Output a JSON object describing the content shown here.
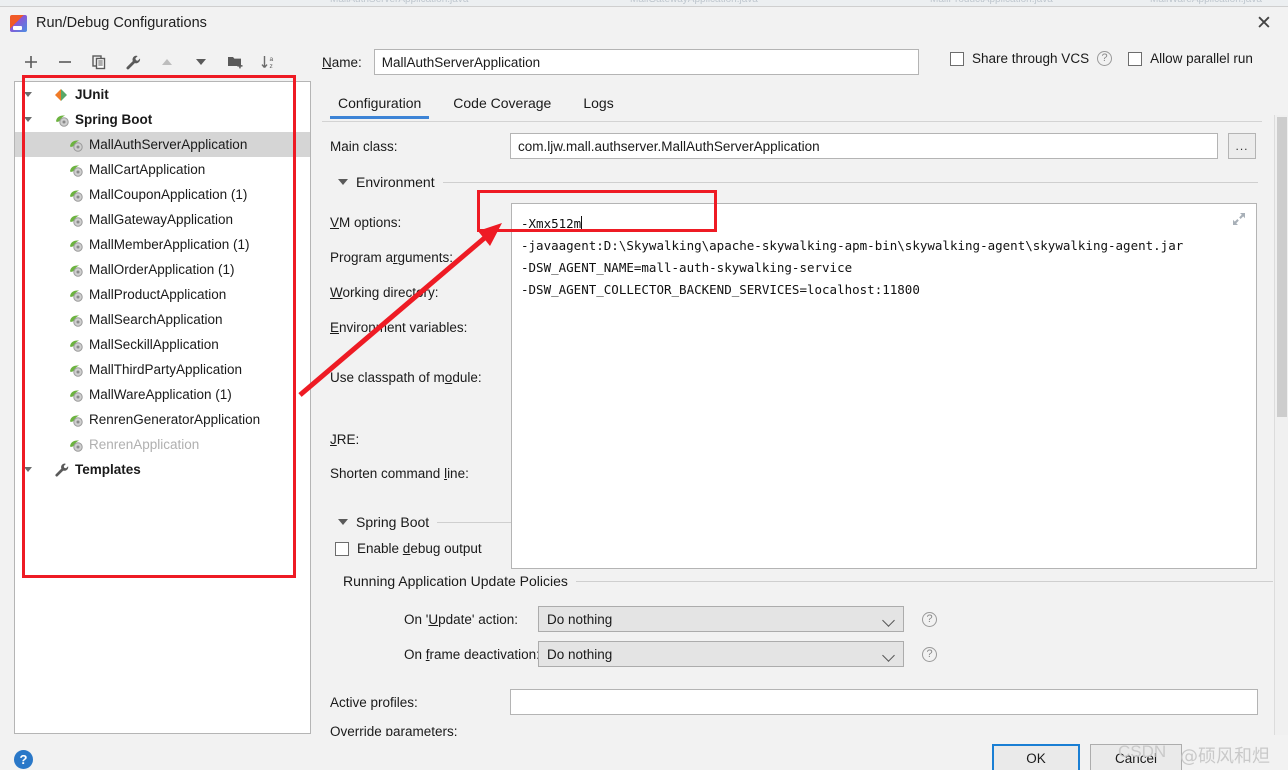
{
  "window": {
    "title": "Run/Debug Configurations",
    "app_icon": "intellij-idea-icon",
    "close_label": "✕"
  },
  "ide_backdrop_tabs": [
    "MallAuthServerApplication.java",
    "MallGatewayApplication.java",
    "MallProductApplication.java",
    "MallWareApplication.java"
  ],
  "toolbar": {
    "items": [
      {
        "name": "add-configuration-button",
        "icon": "plus-icon",
        "tooltip": "Add New Configuration"
      },
      {
        "name": "remove-configuration-button",
        "icon": "minus-icon",
        "tooltip": "Remove Configuration"
      },
      {
        "name": "copy-configuration-button",
        "icon": "copy-icon",
        "tooltip": "Copy Configuration"
      },
      {
        "name": "edit-templates-button",
        "icon": "wrench-icon",
        "tooltip": "Edit Templates"
      },
      {
        "name": "move-up-button",
        "icon": "arrow-up-icon",
        "tooltip": "Move Up"
      },
      {
        "name": "move-down-button",
        "icon": "arrow-down-icon",
        "tooltip": "Move Down"
      },
      {
        "name": "new-folder-button",
        "icon": "folder-add-icon",
        "tooltip": "Create New Folder"
      },
      {
        "name": "sort-button",
        "icon": "sort-alpha-icon",
        "tooltip": "Sort Configurations"
      }
    ]
  },
  "tree": {
    "nodes": [
      {
        "label": "JUnit",
        "icon": "junit-icon",
        "level": 0,
        "bold": true,
        "expandable": true,
        "selected": false,
        "dimmed": false
      },
      {
        "label": "Spring Boot",
        "icon": "spring-boot-icon",
        "level": 0,
        "bold": true,
        "expandable": true,
        "selected": false,
        "dimmed": false
      },
      {
        "label": "MallAuthServerApplication",
        "icon": "spring-boot-icon",
        "level": 1,
        "bold": false,
        "expandable": false,
        "selected": true,
        "dimmed": false
      },
      {
        "label": "MallCartApplication",
        "icon": "spring-boot-icon",
        "level": 1,
        "bold": false,
        "expandable": false,
        "selected": false,
        "dimmed": false
      },
      {
        "label": "MallCouponApplication (1)",
        "icon": "spring-boot-icon",
        "level": 1,
        "bold": false,
        "expandable": false,
        "selected": false,
        "dimmed": false
      },
      {
        "label": "MallGatewayApplication",
        "icon": "spring-boot-icon",
        "level": 1,
        "bold": false,
        "expandable": false,
        "selected": false,
        "dimmed": false
      },
      {
        "label": "MallMemberApplication (1)",
        "icon": "spring-boot-icon",
        "level": 1,
        "bold": false,
        "expandable": false,
        "selected": false,
        "dimmed": false
      },
      {
        "label": "MallOrderApplication (1)",
        "icon": "spring-boot-icon",
        "level": 1,
        "bold": false,
        "expandable": false,
        "selected": false,
        "dimmed": false
      },
      {
        "label": "MallProductApplication",
        "icon": "spring-boot-icon",
        "level": 1,
        "bold": false,
        "expandable": false,
        "selected": false,
        "dimmed": false
      },
      {
        "label": "MallSearchApplication",
        "icon": "spring-boot-icon",
        "level": 1,
        "bold": false,
        "expandable": false,
        "selected": false,
        "dimmed": false
      },
      {
        "label": "MallSeckillApplication",
        "icon": "spring-boot-icon",
        "level": 1,
        "bold": false,
        "expandable": false,
        "selected": false,
        "dimmed": false
      },
      {
        "label": "MallThirdPartyApplication",
        "icon": "spring-boot-icon",
        "level": 1,
        "bold": false,
        "expandable": false,
        "selected": false,
        "dimmed": false
      },
      {
        "label": "MallWareApplication (1)",
        "icon": "spring-boot-icon",
        "level": 1,
        "bold": false,
        "expandable": false,
        "selected": false,
        "dimmed": false
      },
      {
        "label": "RenrenGeneratorApplication",
        "icon": "spring-boot-icon",
        "level": 1,
        "bold": false,
        "expandable": false,
        "selected": false,
        "dimmed": false
      },
      {
        "label": "RenrenApplication",
        "icon": "spring-boot-icon",
        "level": 1,
        "bold": false,
        "expandable": false,
        "selected": false,
        "dimmed": true
      },
      {
        "label": "Templates",
        "icon": "wrench-icon",
        "level": 0,
        "bold": true,
        "expandable": true,
        "selected": false,
        "dimmed": false
      }
    ]
  },
  "header": {
    "name_label": "Name:",
    "name_value": "MallAuthServerApplication",
    "share_vcs_label": "Share through VCS",
    "share_vcs_checked": false,
    "allow_parallel_label": "Allow parallel run",
    "allow_parallel_checked": false,
    "help_icon": "question-mark-icon"
  },
  "tabs": [
    {
      "label": "Configuration",
      "active": true
    },
    {
      "label": "Code Coverage",
      "active": false
    },
    {
      "label": "Logs",
      "active": false
    }
  ],
  "form": {
    "main_class_label": "Main class:",
    "main_class_value": "com.ljw.mall.authserver.MallAuthServerApplication",
    "browse_label": "...",
    "environment_section": "Environment",
    "vm_options_label": "VM options:",
    "program_arguments_label": "Program arguments:",
    "working_directory_label": "Working directory:",
    "environment_variables_label": "Environment variables:",
    "use_classpath_label": "Use classpath of module:",
    "jre_label": "JRE:",
    "shorten_command_line_label": "Shorten command line:",
    "spring_boot_section": "Spring Boot",
    "enable_debug_output_label": "Enable debug output",
    "enable_debug_output_checked": false,
    "running_policies_section": "Running Application Update Policies",
    "on_update_label": "On 'Update' action:",
    "on_update_value": "Do nothing",
    "on_frame_deactivation_label": "On frame deactivation:",
    "on_frame_deactivation_value": "Do nothing",
    "active_profiles_label": "Active profiles:",
    "active_profiles_value": "",
    "override_parameters_label": "Override parameters:"
  },
  "vm_options": {
    "lines": [
      "-Xmx512m",
      "-javaagent:D:\\Skywalking\\apache-skywalking-apm-bin\\skywalking-agent\\skywalking-agent.jar",
      "-DSW_AGENT_NAME=mall-auth-skywalking-service",
      "-DSW_AGENT_COLLECTOR_BACKEND_SERVICES=localhost:11800"
    ],
    "expand_icon": "expand-icon"
  },
  "footer": {
    "help_label": "?",
    "ok_label": "OK",
    "cancel_label": "Cancel"
  },
  "watermark": {
    "csdn": "CSDN",
    "author": "@硕风和炟"
  },
  "annotations": {
    "accent_color": "#ee1b24",
    "shapes": [
      {
        "name": "tree-highlight-box",
        "type": "rect"
      },
      {
        "name": "vm-options-highlight-box",
        "type": "rect"
      },
      {
        "name": "vm-options-pointer-arrow",
        "type": "arrow"
      }
    ]
  },
  "colors": {
    "dialog_bg": "#f2f2f2",
    "panel_bg": "#ffffff",
    "selection": "#d5d5d5",
    "tab_accent": "#3d84d6",
    "ok_border": "#1a7fd4",
    "annotation_red": "#ee1b24",
    "help_blue": "#2a78c8"
  }
}
